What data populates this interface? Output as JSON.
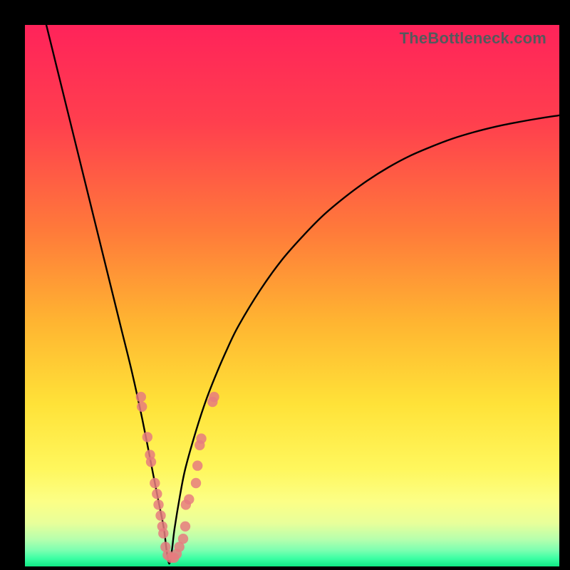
{
  "watermark": "TheBottleneck.com",
  "colors": {
    "frame": "#000000",
    "gradient_stops": [
      {
        "pct": 0,
        "color": "#ff235a"
      },
      {
        "pct": 18,
        "color": "#ff3f4e"
      },
      {
        "pct": 38,
        "color": "#ff7a3a"
      },
      {
        "pct": 55,
        "color": "#ffb531"
      },
      {
        "pct": 70,
        "color": "#ffe238"
      },
      {
        "pct": 82,
        "color": "#fff75d"
      },
      {
        "pct": 88,
        "color": "#fcff86"
      },
      {
        "pct": 92,
        "color": "#e8ff9a"
      },
      {
        "pct": 95,
        "color": "#b6ffad"
      },
      {
        "pct": 97,
        "color": "#7dffb1"
      },
      {
        "pct": 98.5,
        "color": "#3dffa4"
      },
      {
        "pct": 100,
        "color": "#10e884"
      }
    ],
    "curve": "#000000",
    "dots": "#e67b7f"
  },
  "chart_data": {
    "type": "line",
    "title": "",
    "xlabel": "",
    "ylabel": "",
    "xlim": [
      0,
      100
    ],
    "ylim": [
      0,
      100
    ],
    "x_at_minimum": 27,
    "series": [
      {
        "name": "bottleneck-curve",
        "x": [
          4,
          6,
          8,
          10,
          12,
          14,
          16,
          18,
          20,
          22,
          24,
          25,
          26,
          26.5,
          27,
          27.5,
          28,
          29,
          30,
          32,
          34,
          36,
          38,
          40,
          44,
          48,
          52,
          56,
          60,
          64,
          68,
          72,
          76,
          80,
          84,
          88,
          92,
          96,
          100
        ],
        "y": [
          100,
          92,
          84,
          76,
          68,
          60,
          52,
          44,
          36,
          27,
          17,
          12,
          7,
          3,
          0.5,
          3,
          7,
          13,
          18,
          25,
          31,
          36,
          40.5,
          44.5,
          51,
          56.5,
          61,
          65,
          68.3,
          71.2,
          73.7,
          75.8,
          77.5,
          79,
          80.2,
          81.2,
          82,
          82.7,
          83.3
        ]
      }
    ],
    "scatter_overlay": {
      "name": "sample-points",
      "points": [
        {
          "x": 21.7,
          "y": 31.3
        },
        {
          "x": 21.9,
          "y": 29.5
        },
        {
          "x": 22.9,
          "y": 23.9
        },
        {
          "x": 23.4,
          "y": 20.6
        },
        {
          "x": 23.6,
          "y": 19.3
        },
        {
          "x": 24.3,
          "y": 15.4
        },
        {
          "x": 24.7,
          "y": 13.4
        },
        {
          "x": 25.0,
          "y": 11.4
        },
        {
          "x": 25.4,
          "y": 9.4
        },
        {
          "x": 25.7,
          "y": 7.4
        },
        {
          "x": 25.9,
          "y": 6.1
        },
        {
          "x": 26.3,
          "y": 3.6
        },
        {
          "x": 26.7,
          "y": 2.1
        },
        {
          "x": 27.3,
          "y": 1.6
        },
        {
          "x": 27.9,
          "y": 1.6
        },
        {
          "x": 28.4,
          "y": 2.3
        },
        {
          "x": 28.9,
          "y": 3.6
        },
        {
          "x": 29.6,
          "y": 5.1
        },
        {
          "x": 30.0,
          "y": 7.4
        },
        {
          "x": 30.1,
          "y": 11.4
        },
        {
          "x": 30.7,
          "y": 12.4
        },
        {
          "x": 32.0,
          "y": 15.4
        },
        {
          "x": 32.3,
          "y": 18.6
        },
        {
          "x": 32.7,
          "y": 22.4
        },
        {
          "x": 33.0,
          "y": 23.6
        },
        {
          "x": 35.1,
          "y": 30.4
        },
        {
          "x": 35.4,
          "y": 31.3
        }
      ]
    }
  }
}
